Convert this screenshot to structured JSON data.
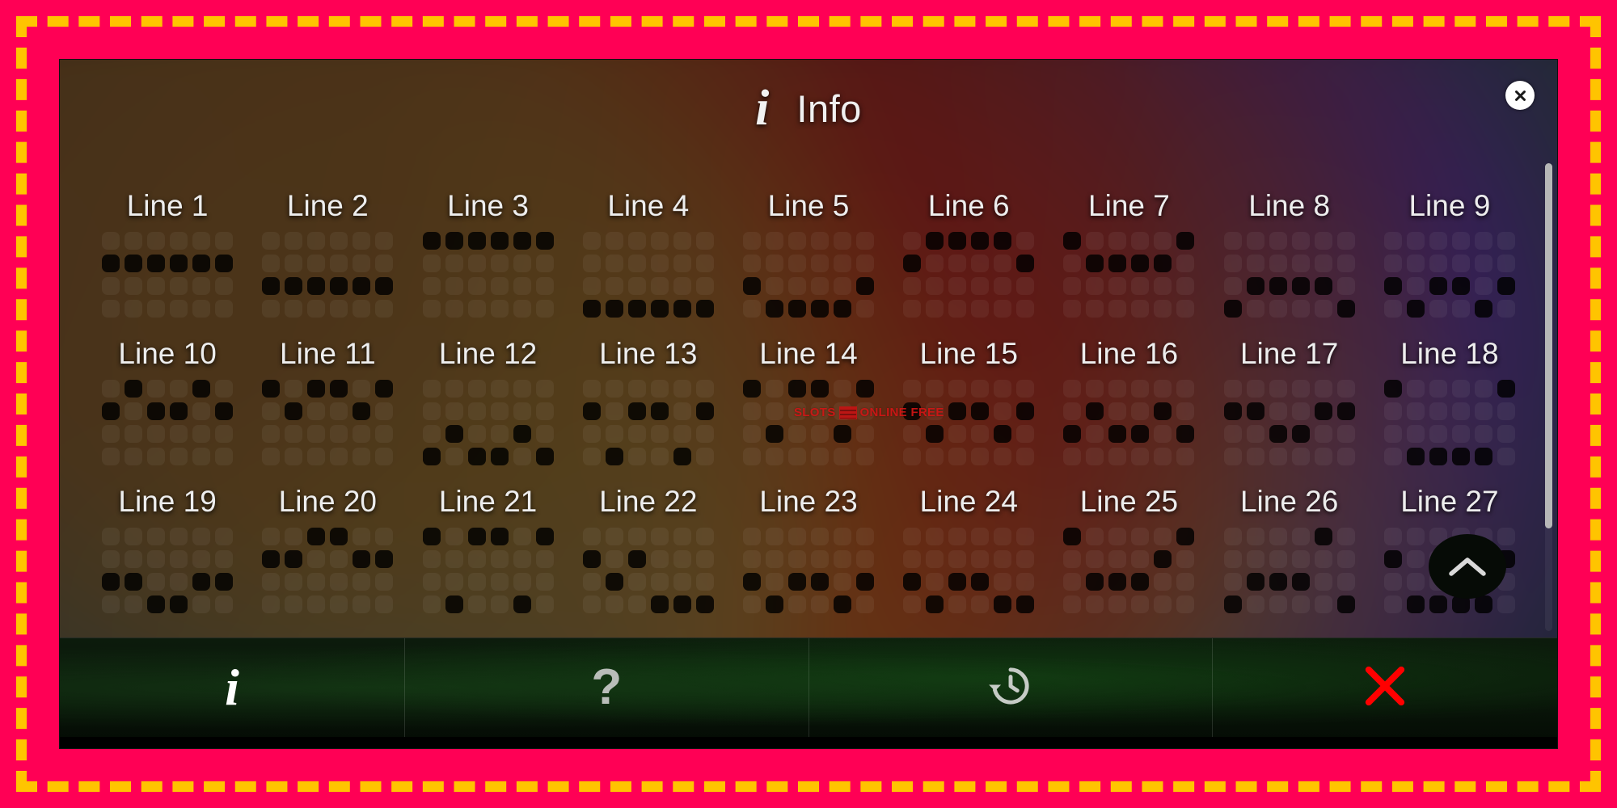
{
  "frame": {
    "border_color": "#FF0055",
    "dash_color": "#FFC400"
  },
  "window": {
    "title": "Info",
    "title_icon": "info-italic-icon",
    "corner_close_icon": "close-circle-icon"
  },
  "watermark": {
    "text_before": "SLOTS",
    "badge": "slots-badge-icon",
    "text_after": "ONLINE FREE",
    "color": "#d21515"
  },
  "scrollbar": {
    "thumb_color": "#b7b7b7",
    "thumb_position_percent": 0
  },
  "scroll_top_button": {
    "label": "scroll-to-top",
    "icon": "chevron-up-icon"
  },
  "paylines": {
    "columns": 6,
    "rows": 4,
    "active_color": "#000000",
    "inactive_color": "rgba(255,255,255,0.055)",
    "lines": [
      {
        "label": "Line 1",
        "cells": [
          [
            1,
            0
          ],
          [
            1,
            1
          ],
          [
            1,
            2
          ],
          [
            1,
            3
          ],
          [
            1,
            4
          ],
          [
            1,
            5
          ]
        ]
      },
      {
        "label": "Line 2",
        "cells": [
          [
            2,
            0
          ],
          [
            2,
            1
          ],
          [
            2,
            2
          ],
          [
            2,
            3
          ],
          [
            2,
            4
          ],
          [
            2,
            5
          ]
        ]
      },
      {
        "label": "Line 3",
        "cells": [
          [
            0,
            0
          ],
          [
            0,
            1
          ],
          [
            0,
            2
          ],
          [
            0,
            3
          ],
          [
            0,
            4
          ],
          [
            0,
            5
          ]
        ]
      },
      {
        "label": "Line 4",
        "cells": [
          [
            3,
            0
          ],
          [
            3,
            1
          ],
          [
            3,
            2
          ],
          [
            3,
            3
          ],
          [
            3,
            4
          ],
          [
            3,
            5
          ]
        ]
      },
      {
        "label": "Line 5",
        "cells": [
          [
            2,
            0
          ],
          [
            3,
            1
          ],
          [
            3,
            2
          ],
          [
            3,
            3
          ],
          [
            3,
            4
          ],
          [
            2,
            5
          ]
        ]
      },
      {
        "label": "Line 6",
        "cells": [
          [
            1,
            0
          ],
          [
            0,
            1
          ],
          [
            0,
            2
          ],
          [
            0,
            3
          ],
          [
            0,
            4
          ],
          [
            1,
            5
          ]
        ]
      },
      {
        "label": "Line 7",
        "cells": [
          [
            0,
            0
          ],
          [
            1,
            1
          ],
          [
            1,
            2
          ],
          [
            1,
            3
          ],
          [
            1,
            4
          ],
          [
            0,
            5
          ]
        ]
      },
      {
        "label": "Line 8",
        "cells": [
          [
            3,
            0
          ],
          [
            2,
            1
          ],
          [
            2,
            2
          ],
          [
            2,
            3
          ],
          [
            2,
            4
          ],
          [
            3,
            5
          ]
        ]
      },
      {
        "label": "Line 9",
        "cells": [
          [
            2,
            0
          ],
          [
            3,
            1
          ],
          [
            2,
            2
          ],
          [
            2,
            3
          ],
          [
            3,
            4
          ],
          [
            2,
            5
          ]
        ]
      },
      {
        "label": "Line 10",
        "cells": [
          [
            1,
            0
          ],
          [
            0,
            1
          ],
          [
            1,
            2
          ],
          [
            1,
            3
          ],
          [
            0,
            4
          ],
          [
            1,
            5
          ]
        ]
      },
      {
        "label": "Line 11",
        "cells": [
          [
            0,
            0
          ],
          [
            1,
            1
          ],
          [
            0,
            2
          ],
          [
            0,
            3
          ],
          [
            1,
            4
          ],
          [
            0,
            5
          ]
        ]
      },
      {
        "label": "Line 12",
        "cells": [
          [
            3,
            0
          ],
          [
            2,
            1
          ],
          [
            3,
            2
          ],
          [
            3,
            3
          ],
          [
            2,
            4
          ],
          [
            3,
            5
          ]
        ]
      },
      {
        "label": "Line 13",
        "cells": [
          [
            1,
            0
          ],
          [
            3,
            1
          ],
          [
            1,
            2
          ],
          [
            1,
            3
          ],
          [
            3,
            4
          ],
          [
            1,
            5
          ]
        ]
      },
      {
        "label": "Line 14",
        "cells": [
          [
            0,
            0
          ],
          [
            2,
            1
          ],
          [
            0,
            2
          ],
          [
            0,
            3
          ],
          [
            2,
            4
          ],
          [
            0,
            5
          ]
        ]
      },
      {
        "label": "Line 15",
        "cells": [
          [
            1,
            0
          ],
          [
            2,
            1
          ],
          [
            1,
            2
          ],
          [
            1,
            3
          ],
          [
            2,
            4
          ],
          [
            1,
            5
          ]
        ]
      },
      {
        "label": "Line 16",
        "cells": [
          [
            2,
            0
          ],
          [
            1,
            1
          ],
          [
            2,
            2
          ],
          [
            2,
            3
          ],
          [
            1,
            4
          ],
          [
            2,
            5
          ]
        ]
      },
      {
        "label": "Line 17",
        "cells": [
          [
            1,
            0
          ],
          [
            1,
            1
          ],
          [
            2,
            2
          ],
          [
            2,
            3
          ],
          [
            1,
            4
          ],
          [
            1,
            5
          ]
        ]
      },
      {
        "label": "Line 18",
        "cells": [
          [
            0,
            0
          ],
          [
            3,
            1
          ],
          [
            3,
            2
          ],
          [
            3,
            3
          ],
          [
            3,
            4
          ],
          [
            0,
            5
          ]
        ]
      },
      {
        "label": "Line 19",
        "cells": [
          [
            2,
            0
          ],
          [
            2,
            1
          ],
          [
            3,
            2
          ],
          [
            3,
            3
          ],
          [
            2,
            4
          ],
          [
            2,
            5
          ]
        ]
      },
      {
        "label": "Line 20",
        "cells": [
          [
            1,
            0
          ],
          [
            1,
            1
          ],
          [
            0,
            2
          ],
          [
            0,
            3
          ],
          [
            1,
            4
          ],
          [
            1,
            5
          ]
        ]
      },
      {
        "label": "Line 21",
        "cells": [
          [
            0,
            0
          ],
          [
            3,
            1
          ],
          [
            0,
            2
          ],
          [
            0,
            3
          ],
          [
            3,
            4
          ],
          [
            0,
            5
          ]
        ]
      },
      {
        "label": "Line 22",
        "cells": [
          [
            1,
            0
          ],
          [
            2,
            1
          ],
          [
            1,
            2
          ],
          [
            3,
            3
          ],
          [
            3,
            4
          ],
          [
            3,
            5
          ]
        ]
      },
      {
        "label": "Line 23",
        "cells": [
          [
            2,
            0
          ],
          [
            3,
            1
          ],
          [
            2,
            2
          ],
          [
            2,
            3
          ],
          [
            3,
            4
          ],
          [
            2,
            5
          ]
        ]
      },
      {
        "label": "Line 24",
        "cells": [
          [
            2,
            0
          ],
          [
            3,
            1
          ],
          [
            2,
            2
          ],
          [
            2,
            3
          ],
          [
            3,
            4
          ],
          [
            3,
            5
          ]
        ]
      },
      {
        "label": "Line 25",
        "cells": [
          [
            0,
            0
          ],
          [
            2,
            1
          ],
          [
            2,
            2
          ],
          [
            2,
            3
          ],
          [
            1,
            4
          ],
          [
            0,
            5
          ]
        ]
      },
      {
        "label": "Line 26",
        "cells": [
          [
            3,
            0
          ],
          [
            2,
            1
          ],
          [
            2,
            2
          ],
          [
            2,
            3
          ],
          [
            0,
            4
          ],
          [
            3,
            5
          ]
        ]
      },
      {
        "label": "Line 27",
        "cells": [
          [
            1,
            0
          ],
          [
            3,
            1
          ],
          [
            3,
            2
          ],
          [
            3,
            3
          ],
          [
            3,
            4
          ],
          [
            1,
            5
          ]
        ]
      }
    ]
  },
  "toolbar": {
    "buttons": [
      {
        "name": "info-button",
        "icon": "info-italic-icon",
        "glyph": "i",
        "state": "active"
      },
      {
        "name": "help-button",
        "icon": "question-mark-icon",
        "glyph": "?",
        "state": "idle"
      },
      {
        "name": "history-button",
        "icon": "history-clock-icon",
        "glyph": "",
        "state": "idle"
      },
      {
        "name": "close-button",
        "icon": "close-x-icon",
        "glyph": "",
        "state": "idle"
      }
    ]
  }
}
